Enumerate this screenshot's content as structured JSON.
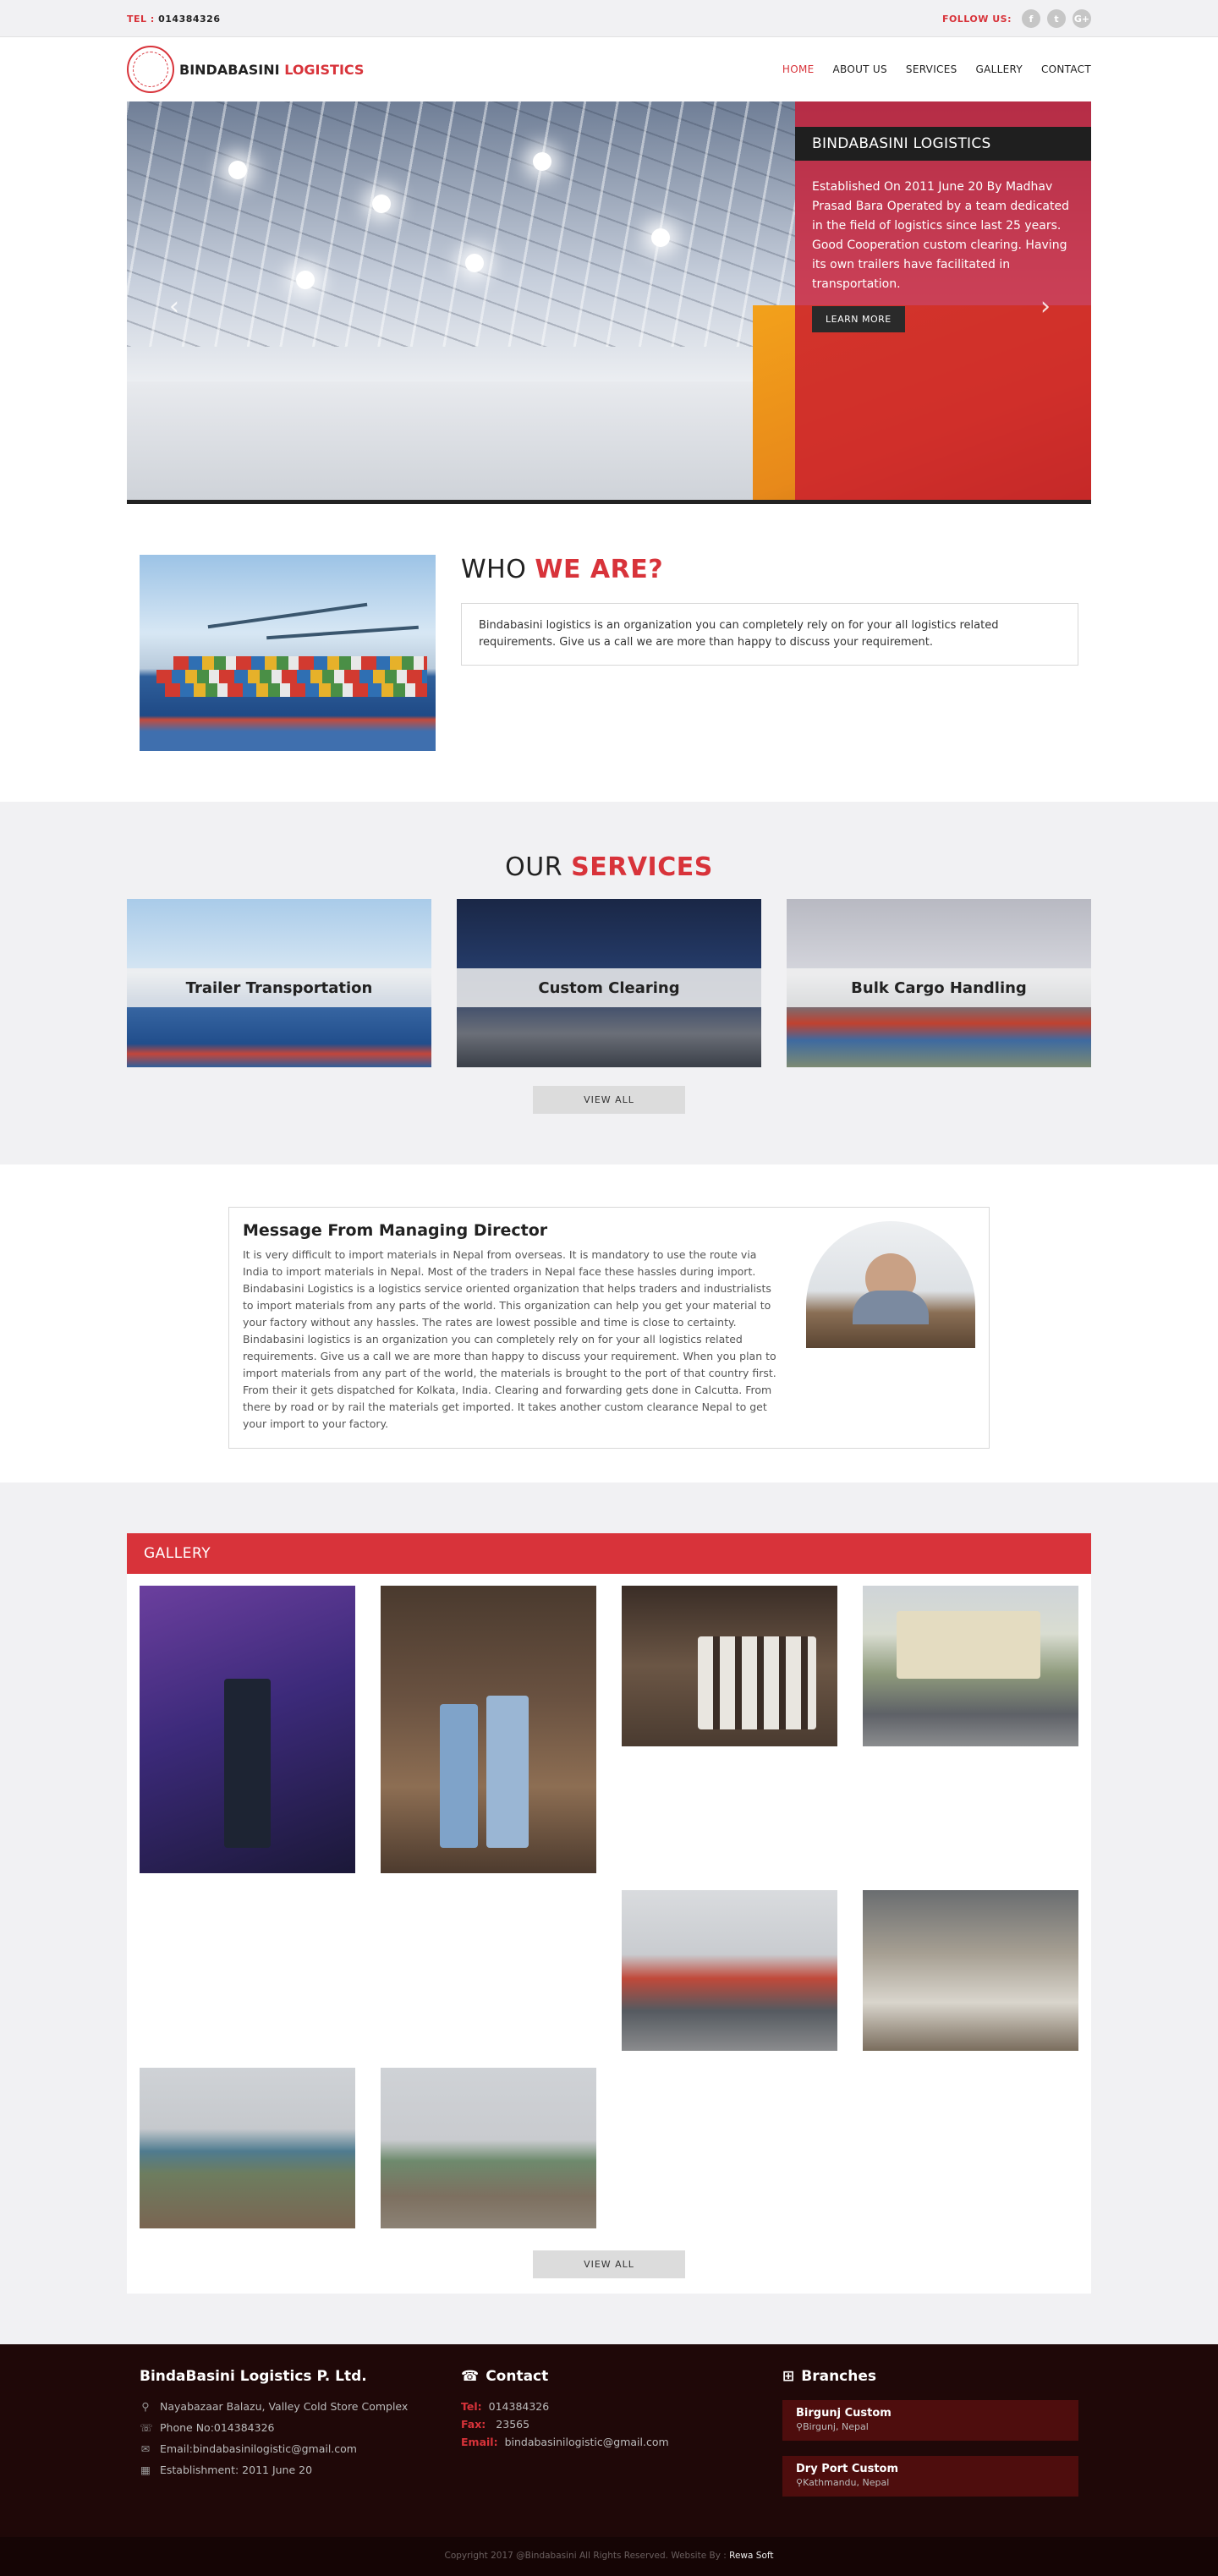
{
  "topbar": {
    "tel_label": "TEL :",
    "tel_value": "014384326",
    "follow_label": "FOLLOW US:",
    "social": [
      {
        "icon": "facebook-icon",
        "glyph": "f"
      },
      {
        "icon": "twitter-icon",
        "glyph": "t"
      },
      {
        "icon": "google-plus-icon",
        "glyph": "G+"
      }
    ]
  },
  "header": {
    "brand_main": "BINDABASINI",
    "brand_accent": "LOGISTICS",
    "nav": [
      {
        "label": "HOME",
        "active": true
      },
      {
        "label": "ABOUT US"
      },
      {
        "label": "SERVICES"
      },
      {
        "label": "GALLERY"
      },
      {
        "label": "CONTACT"
      }
    ]
  },
  "hero": {
    "title": "BINDABASINI LOGISTICS",
    "text": "Established On 2011 June 20 By Madhav Prasad Bara Operated by a team dedicated in the field of logistics since last 25 years. Good Cooperation custom clearing. Having its own trailers have facilitated in transportation.",
    "button": "LEARN MORE",
    "prev_icon": "chevron-left-icon",
    "next_icon": "chevron-right-icon"
  },
  "who": {
    "title_plain": "WHO ",
    "title_accent": "WE ARE?",
    "text": "Bindabasini logistics is an organization you can completely rely on for your all logistics related requirements. Give us a call we are more than happy to discuss your requirement."
  },
  "services": {
    "title_plain": "OUR ",
    "title_accent": "SERVICES",
    "items": [
      {
        "label": "Trailer Transportation"
      },
      {
        "label": "Custom Clearing"
      },
      {
        "label": "Bulk Cargo Handling"
      }
    ],
    "button": "VIEW ALL"
  },
  "message": {
    "title": "Message From Managing Director",
    "text": "It is very difficult to import materials in Nepal from overseas. It is mandatory to use the route via India to import materials in Nepal. Most of the traders in Nepal face these hassles during import. Bindabasini Logistics is a logistics service oriented organization that helps traders and industrialists to import materials from any parts of the world. This organization can help you get your material to your factory without any hassles. The rates are lowest possible and time is close to certainty. Bindabasini logistics is an organization you can completely rely on for your all logistics related requirements. Give us a call we are more than happy to discuss your requirement. When you plan to import materials from any part of the world, the materials is brought to the port of that country first. From their it gets dispatched for Kolkata, India. Clearing and forwarding gets done in Calcutta. From there by road or by rail the materials get imported.  It takes another custom clearance Nepal to get your import to your factory."
  },
  "gallery": {
    "title": "GALLERY",
    "button": "VIEW ALL"
  },
  "footer": {
    "company": "BindaBasini Logistics P. Ltd.",
    "info": [
      {
        "icon": "map-marker-icon",
        "glyph": "⚲",
        "text": "Nayabazaar Balazu, Valley Cold Store Complex"
      },
      {
        "icon": "phone-icon",
        "glyph": "☏",
        "text": "Phone No:014384326"
      },
      {
        "icon": "envelope-icon",
        "glyph": "✉",
        "text": "Email:bindabasinilogistic@gmail.com"
      },
      {
        "icon": "calendar-icon",
        "glyph": "▦",
        "text": "Establishment:  2011 June 20"
      }
    ],
    "contact_title": "Contact",
    "contact": [
      {
        "label": "Tel:",
        "value": "014384326"
      },
      {
        "label": "Fax:",
        "value": " 23565"
      },
      {
        "label": "Email:",
        "value": "bindabasinilogistic@gmail.com"
      }
    ],
    "branches_title": "Branches",
    "branches": [
      {
        "name": "Birgunj Custom",
        "location": "Birgunj, Nepal"
      },
      {
        "name": "Dry Port Custom",
        "location": "Kathmandu, Nepal"
      }
    ],
    "copyright": "Copyright 2017 @Bindabasini All Rights Reserved. Website By : ",
    "credit": "Rewa Soft"
  },
  "colors": {
    "accent": "#d8333a",
    "footer_bg": "#1f0808",
    "branch_bg": "#4e0d0d"
  }
}
